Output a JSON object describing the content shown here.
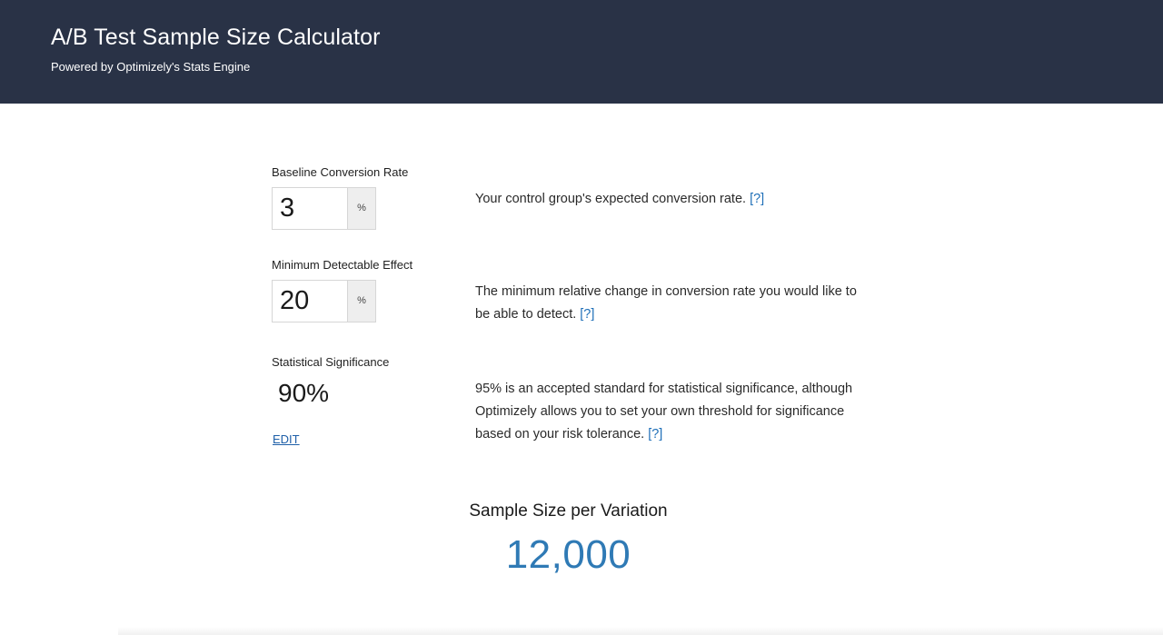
{
  "header": {
    "title": "A/B Test Sample Size Calculator",
    "subtitle": "Powered by Optimizely's Stats Engine"
  },
  "baseline": {
    "label": "Baseline Conversion Rate",
    "value": "3",
    "unit": "%",
    "description": "Your control group's expected conversion rate.",
    "help": "[?]"
  },
  "mde": {
    "label": "Minimum Detectable Effect",
    "value": "20",
    "unit": "%",
    "description": "The minimum relative change in conversion rate you would like to be able to detect.",
    "help": "[?]"
  },
  "significance": {
    "label": "Statistical Significance",
    "value": "90%",
    "edit_label": "EDIT",
    "description": "95% is an accepted standard for statistical significance, although Optimizely allows you to set your own threshold for significance based on your risk tolerance.",
    "help": "[?]"
  },
  "result": {
    "label": "Sample Size per Variation",
    "value": "12,000"
  },
  "colors": {
    "header_bg": "#293246",
    "result_blue": "#2f7ab5",
    "link_blue": "#1e6fb8"
  }
}
